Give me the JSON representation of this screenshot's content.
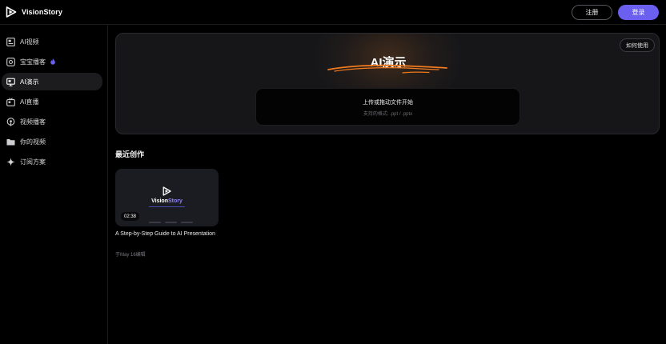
{
  "app": {
    "name": "VisionStory"
  },
  "header": {
    "register_label": "注册",
    "login_label": "登录"
  },
  "sidebar": {
    "items": [
      {
        "label": "AI视频",
        "icon": "video-frame-icon"
      },
      {
        "label": "宝宝播客",
        "icon": "baby-podcast-icon",
        "badge_icon": "flame-icon"
      },
      {
        "label": "AI演示",
        "icon": "presentation-icon",
        "active": true
      },
      {
        "label": "AI直播",
        "icon": "tv-icon"
      },
      {
        "label": "视频播客",
        "icon": "podcast-icon"
      },
      {
        "label": "你的视频",
        "icon": "folder-icon"
      },
      {
        "label": "订阅方案",
        "icon": "sparkle-icon"
      }
    ]
  },
  "hero": {
    "title": "AI演示",
    "howto_label": "如何使用",
    "upload_label": "上传或拖动文件开始",
    "formats_label": "支持的格式: .ppt / .pptx"
  },
  "recent": {
    "title": "最近创作",
    "items": [
      {
        "title": "A Step-by-Step Guide to AI Presentation",
        "duration": "02:38",
        "meta": "于May 16编辑",
        "thumb_brand_a": "Vision",
        "thumb_brand_b": "Story"
      }
    ]
  },
  "colors": {
    "accent": "#6b5ff0",
    "highlight": "#f07a1e",
    "background": "#000000"
  }
}
